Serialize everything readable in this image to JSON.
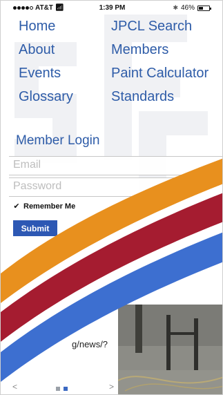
{
  "status_bar": {
    "carrier": "AT&T",
    "time": "1:39 PM",
    "battery": "46%",
    "battery_level": 0.46
  },
  "nav": {
    "left": [
      "Home",
      "About",
      "Events",
      "Glossary"
    ],
    "right": [
      "JPCL Search",
      "Members",
      "Paint Calculator",
      "Standards"
    ]
  },
  "login": {
    "title": "Member Login",
    "email_placeholder": "Email",
    "password_placeholder": "Password",
    "remember_label": "Remember Me",
    "remember_checked": true,
    "submit_label": "Submit"
  },
  "slider": {
    "caption": "g/news/?",
    "prev": "<",
    "next": ">",
    "page_count": 2,
    "active_index": 1
  },
  "colors": {
    "link": "#2e5ca8",
    "submit": "#2d58b4",
    "stripe_orange": "#e8901e",
    "stripe_red": "#a51c30",
    "stripe_blue": "#3d6fd0"
  }
}
